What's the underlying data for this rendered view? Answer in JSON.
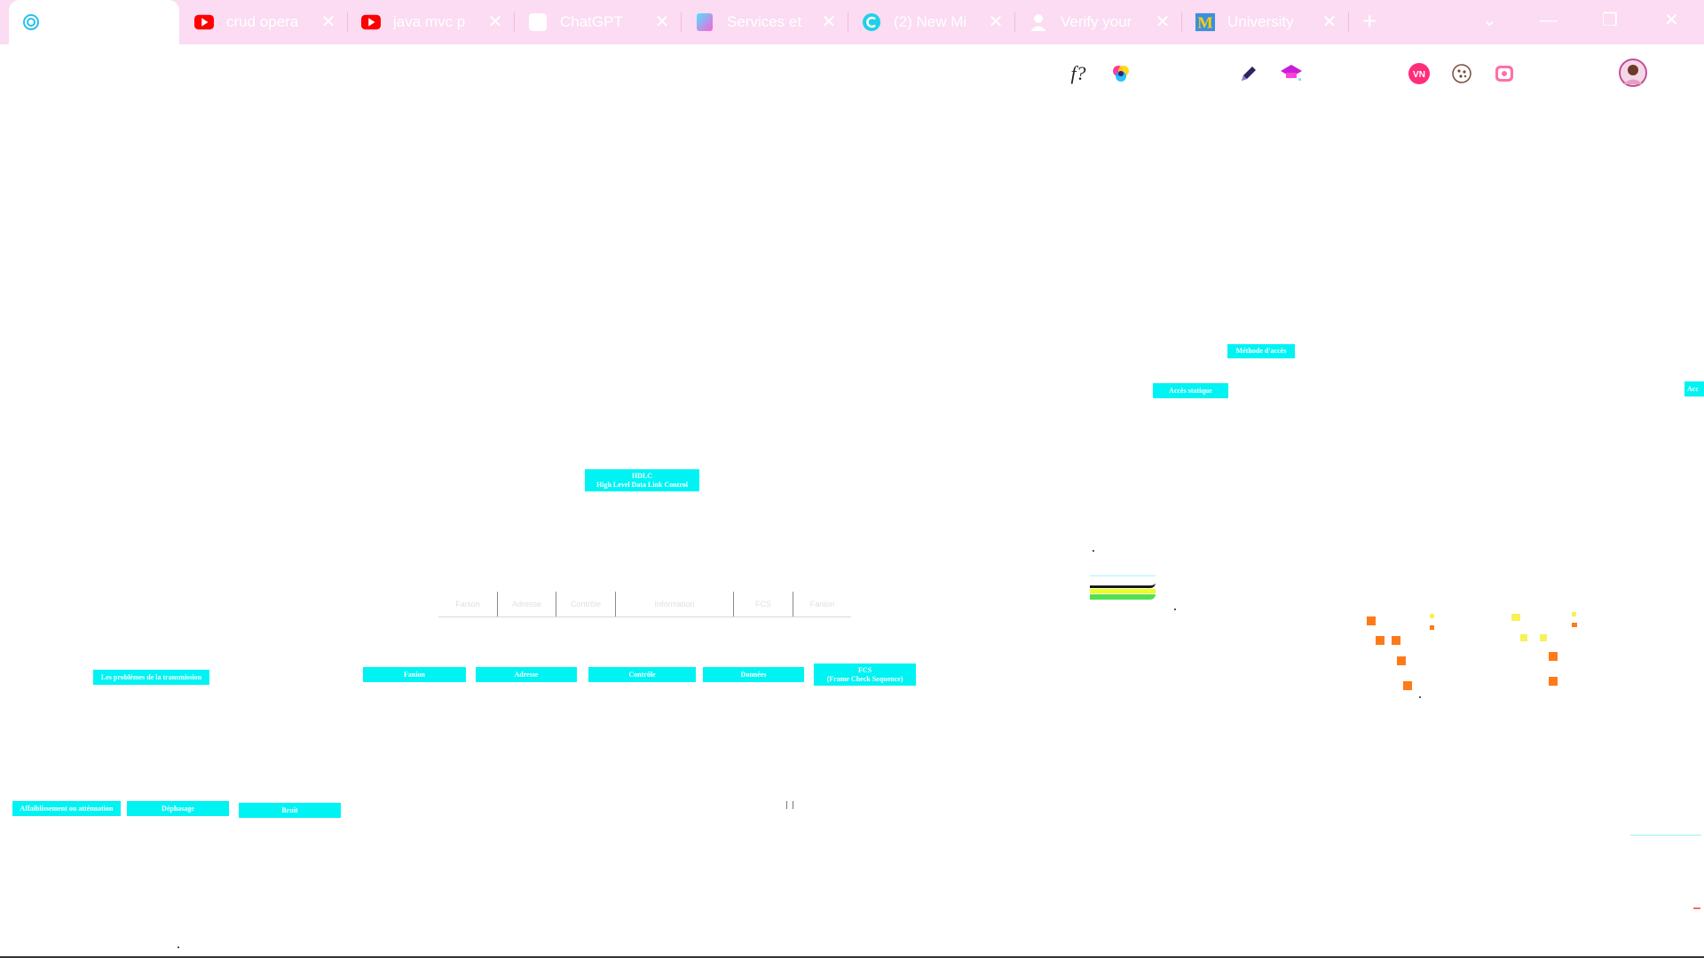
{
  "browser": {
    "tabs": [
      {
        "title": "",
        "favicon": "spiral-icon",
        "active": true
      },
      {
        "title": "crud opera",
        "favicon": "youtube-icon"
      },
      {
        "title": "java mvc p",
        "favicon": "youtube-icon"
      },
      {
        "title": "ChatGPT",
        "favicon": "chatgpt-icon"
      },
      {
        "title": "Services et",
        "favicon": "gradient-page-icon"
      },
      {
        "title": "(2) New Mi",
        "favicon": "c-circle-icon"
      },
      {
        "title": "Verify your",
        "favicon": "user-icon"
      },
      {
        "title": "University",
        "favicon": "umich-icon"
      }
    ],
    "close_glyph": "✕",
    "new_tab_glyph": "+",
    "window_controls": {
      "dropdown": "⌄",
      "minimize": "—",
      "restore": "❐",
      "close": "✕"
    },
    "tab_bar_color": "#fbdcf2"
  },
  "toolbar": {
    "formula_label": "f?",
    "extensions": [
      "formula-icon",
      "color-wheel-icon",
      "pencil-icon",
      "graduation-cap-icon",
      "vn-badge-icon",
      "cookie-icon",
      "screen-record-icon",
      "profile-avatar-icon"
    ]
  },
  "diagram": {
    "accent_color": "#00f3f3",
    "hdlc_title_line1": "HDLC",
    "hdlc_title_line2": "High Level Data Link Control",
    "frame_fields": [
      "Fanion",
      "Adresse",
      "Contrôle",
      "Information",
      "FCS",
      "Fanion"
    ],
    "field_boxes": [
      "Fanion",
      "Adresse",
      "Contrôle",
      "Données",
      "FCS",
      "(Frame Check Sequence)"
    ],
    "problems_label": "Les problèmes de la transmission",
    "problem_boxes": [
      "Affaiblissement ou atténuation",
      "Déphasage",
      "Bruit"
    ],
    "access_method": "Méthode d'accès",
    "static_access": "Accès statique",
    "access_right_partial": "Acc"
  }
}
